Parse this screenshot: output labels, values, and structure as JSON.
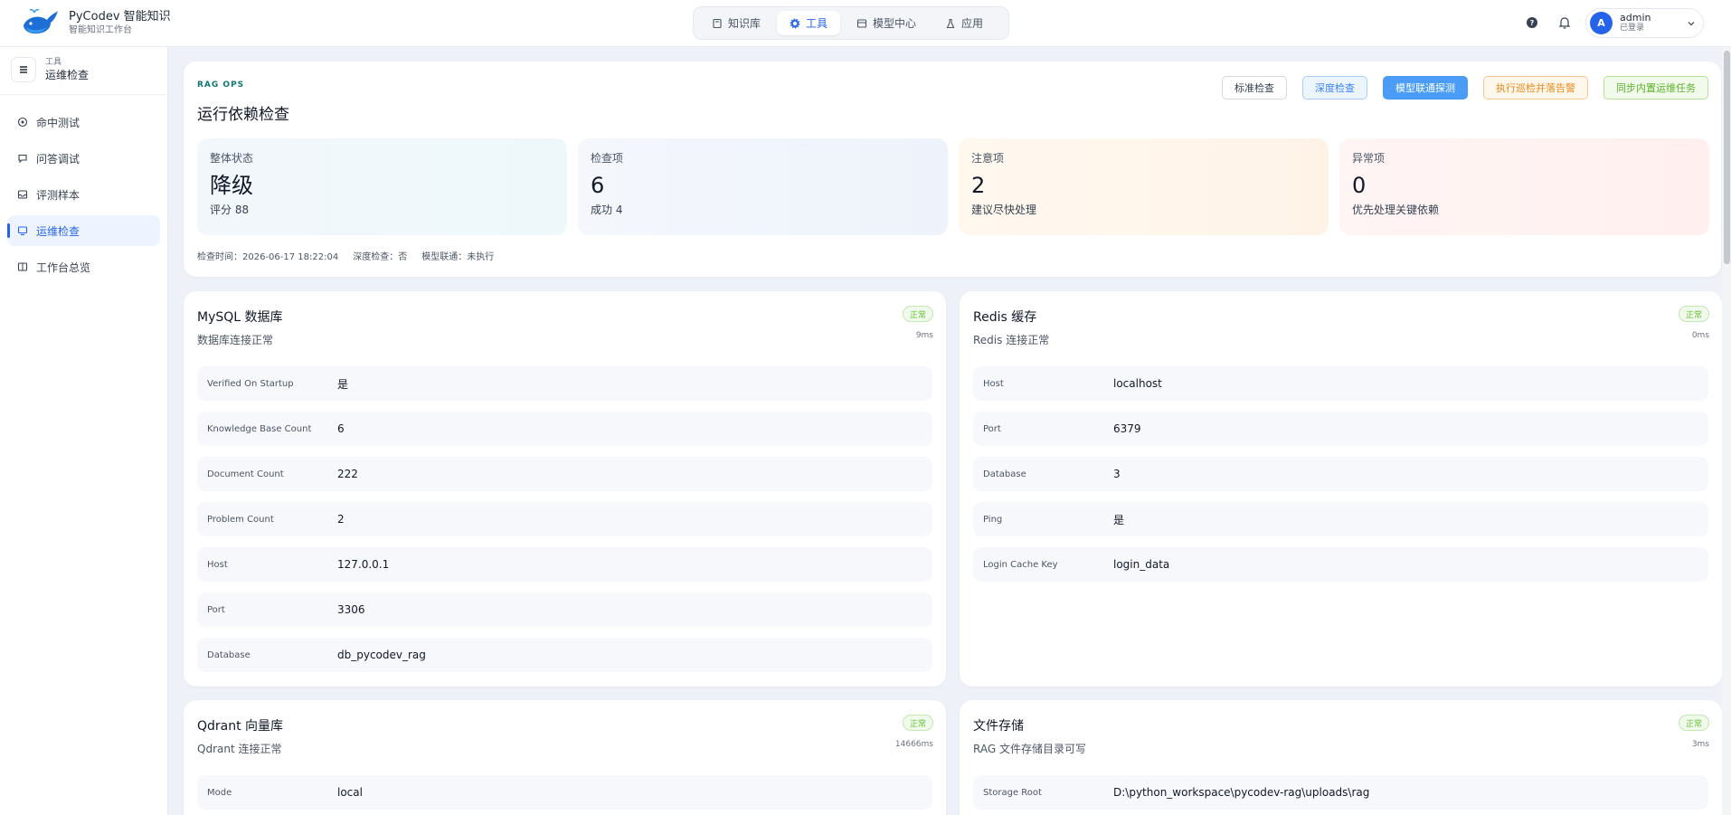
{
  "brand": {
    "name": "PyCodev 智能知识",
    "subtitle": "智能知识工作台"
  },
  "topnav": [
    {
      "label": "知识库",
      "icon": "book-icon",
      "active": false
    },
    {
      "label": "工具",
      "icon": "gear-icon",
      "active": true
    },
    {
      "label": "模型中心",
      "icon": "box-icon",
      "active": false
    },
    {
      "label": "应用",
      "icon": "flask-icon",
      "active": false
    }
  ],
  "user": {
    "initial": "A",
    "name": "admin",
    "status": "已登录"
  },
  "sidebar": {
    "crumb": "工具",
    "title": "运维检查",
    "items": [
      {
        "label": "命中测试",
        "icon": "target-icon",
        "active": false
      },
      {
        "label": "问答调试",
        "icon": "chat-icon",
        "active": false
      },
      {
        "label": "评测样本",
        "icon": "tray-icon",
        "active": false
      },
      {
        "label": "运维检查",
        "icon": "monitor-icon",
        "active": true
      },
      {
        "label": "工作台总览",
        "icon": "dashboard-icon",
        "active": false
      }
    ]
  },
  "overview": {
    "eyebrow": "RAG OPS",
    "title": "运行依赖检查",
    "actions": {
      "standard": "标准检查",
      "deep": "深度检查",
      "probe": "模型联通探测",
      "patrol": "执行巡检并落告警",
      "sync": "同步内置运维任务"
    },
    "stats": [
      {
        "label": "整体状态",
        "value": "降级",
        "desc": "评分 88"
      },
      {
        "label": "检查项",
        "value": "6",
        "desc": "成功 4"
      },
      {
        "label": "注意项",
        "value": "2",
        "desc": "建议尽快处理"
      },
      {
        "label": "异常项",
        "value": "0",
        "desc": "优先处理关键依赖"
      }
    ],
    "meta": {
      "time": "检查时间：2026-06-17 18:22:04",
      "deep": "深度检查：否",
      "model": "模型联通：未执行"
    }
  },
  "services": [
    {
      "title": "MySQL 数据库",
      "subtitle": "数据库连接正常",
      "status": "正常",
      "latency": "9ms",
      "rows": [
        {
          "key": "Verified On Startup",
          "value": "是"
        },
        {
          "key": "Knowledge Base Count",
          "value": "6"
        },
        {
          "key": "Document Count",
          "value": "222"
        },
        {
          "key": "Problem Count",
          "value": "2"
        },
        {
          "key": "Host",
          "value": "127.0.0.1"
        },
        {
          "key": "Port",
          "value": "3306"
        },
        {
          "key": "Database",
          "value": "db_pycodev_rag"
        }
      ]
    },
    {
      "title": "Redis 缓存",
      "subtitle": "Redis 连接正常",
      "status": "正常",
      "latency": "0ms",
      "rows": [
        {
          "key": "Host",
          "value": "localhost"
        },
        {
          "key": "Port",
          "value": "6379"
        },
        {
          "key": "Database",
          "value": "3"
        },
        {
          "key": "Ping",
          "value": "是"
        },
        {
          "key": "Login Cache Key",
          "value": "login_data"
        }
      ]
    },
    {
      "title": "Qdrant 向量库",
      "subtitle": "Qdrant 连接正常",
      "status": "正常",
      "latency": "14666ms",
      "rows": [
        {
          "key": "Mode",
          "value": "local"
        }
      ]
    },
    {
      "title": "文件存储",
      "subtitle": "RAG 文件存储目录可写",
      "status": "正常",
      "latency": "3ms",
      "rows": [
        {
          "key": "Storage Root",
          "value": "D:\\python_workspace\\pycodev-rag\\uploads\\rag"
        }
      ]
    }
  ]
}
